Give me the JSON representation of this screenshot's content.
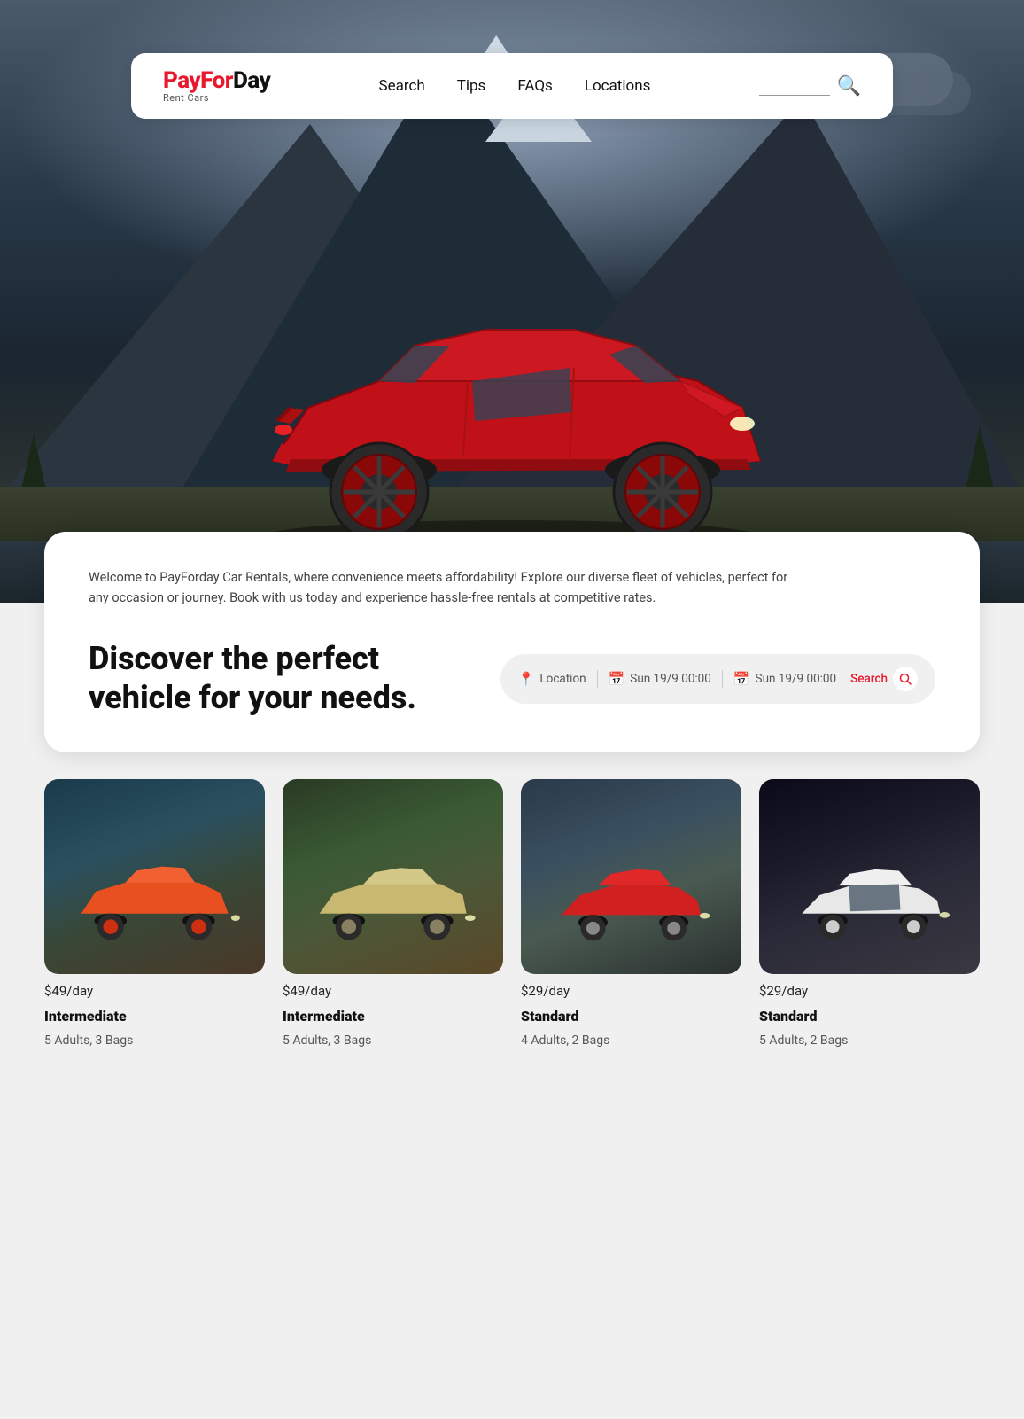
{
  "brand": {
    "name_red": "PayForDay",
    "name_black": "",
    "sub": "Rent Cars"
  },
  "nav": {
    "items": [
      {
        "label": "Search",
        "id": "nav-search"
      },
      {
        "label": "Tips",
        "id": "nav-tips"
      },
      {
        "label": "FAQs",
        "id": "nav-faqs"
      },
      {
        "label": "Locations",
        "id": "nav-locations"
      }
    ]
  },
  "welcome": {
    "text": "Welcome to PayForday Car Rentals, where convenience meets affordability! Explore our diverse fleet of vehicles, perfect for any occasion or journey. Book with us today and experience hassle-free rentals at competitive rates."
  },
  "discover": {
    "heading_line1": "Discover the perfect",
    "heading_line2": "vehicle for your needs."
  },
  "search_widget": {
    "location_label": "Location",
    "location_icon": "📍",
    "date1_icon": "📅",
    "date1_label": "Sun 19/9 00:00",
    "date2_icon": "📅",
    "date2_label": "Sun 19/9 00:00",
    "search_label": "Search",
    "search_icon": "🔍"
  },
  "cars": [
    {
      "price": "$49/day",
      "name": "Intermediate",
      "capacity": "5 Adults, 3 Bags",
      "bg_class": "car-bg-1"
    },
    {
      "price": "$49/day",
      "name": "Intermediate",
      "capacity": "5 Adults, 3 Bags",
      "bg_class": "car-bg-2"
    },
    {
      "price": "$29/day",
      "name": "Standard",
      "capacity": "4 Adults, 2 Bags",
      "bg_class": "car-bg-3"
    },
    {
      "price": "$29/day",
      "name": "Standard",
      "capacity": "5 Adults, 2 Bags",
      "bg_class": "car-bg-4"
    }
  ],
  "colors": {
    "accent": "#e8192c",
    "dark": "#111111",
    "mid": "#555555",
    "light_bg": "#f0f0f0"
  }
}
